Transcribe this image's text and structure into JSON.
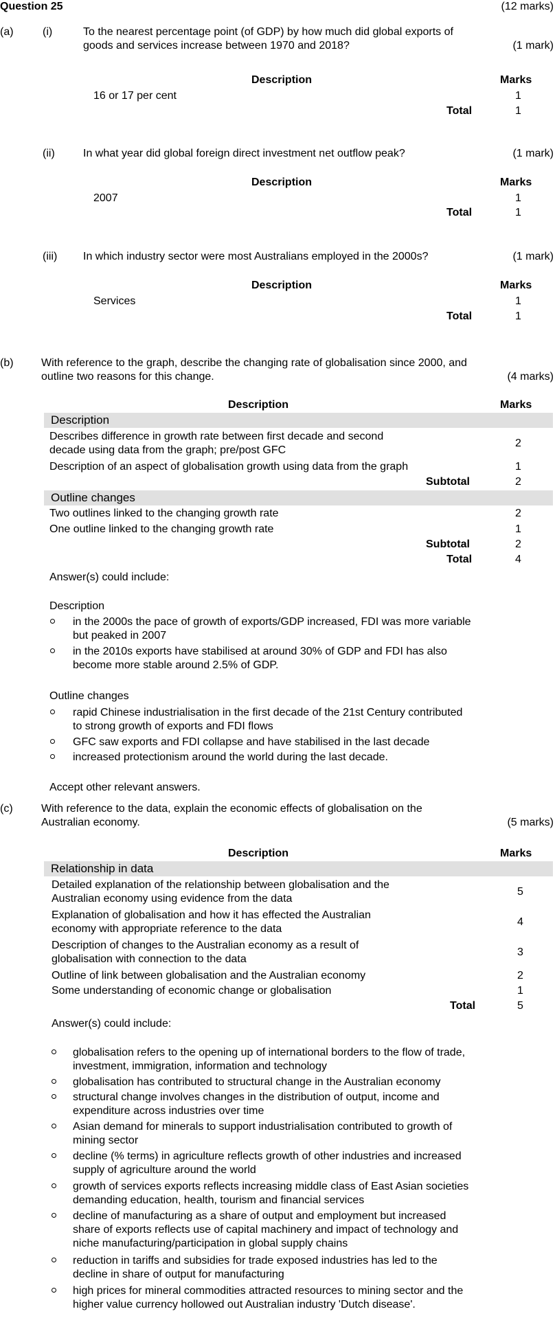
{
  "question": {
    "title": "Question 25",
    "marks": "(12 marks)"
  },
  "a": {
    "label": "(a)",
    "desc_header": "Description",
    "marks_header": "Marks",
    "total_label": "Total",
    "parts": [
      {
        "label": "(i)",
        "question_lines": [
          "To the nearest percentage point (of GDP) by how much did global exports of",
          "goods and services increase between 1970 and 2018?"
        ],
        "marks": "(1 mark)",
        "answer": "16 or 17 per cent",
        "answer_mark": "1",
        "total": "1"
      },
      {
        "label": "(ii)",
        "question_lines": [
          "In what year did global foreign direct investment net outflow peak?"
        ],
        "marks": "(1 mark)",
        "answer": "2007",
        "answer_mark": "1",
        "total": "1"
      },
      {
        "label": "(iii)",
        "question_lines": [
          "In which industry sector were most Australians employed in the 2000s?"
        ],
        "marks": "(1 mark)",
        "answer": "Services",
        "answer_mark": "1",
        "total": "1"
      }
    ]
  },
  "b": {
    "label": "(b)",
    "question_lines": [
      "With reference to the graph, describe the changing rate of globalisation since 2000, and",
      "outline two reasons for this change."
    ],
    "marks": "(4 marks)",
    "desc_header": "Description",
    "marks_header": "Marks",
    "sections": [
      {
        "title": "Description",
        "rows": [
          {
            "lines": [
              "Describes difference in growth rate between first decade and second",
              "decade using data from the graph; pre/post GFC"
            ],
            "mark": "2"
          },
          {
            "lines": [
              "Description of an aspect of globalisation growth using data from the graph"
            ],
            "mark": "1"
          }
        ],
        "subtotal_label": "Subtotal",
        "subtotal": "2"
      },
      {
        "title": "Outline changes",
        "rows": [
          {
            "lines": [
              "Two outlines linked to the changing growth rate"
            ],
            "mark": "2"
          },
          {
            "lines": [
              "One outline linked to the changing growth rate"
            ],
            "mark": "1"
          }
        ],
        "subtotal_label": "Subtotal",
        "subtotal": "2"
      }
    ],
    "total_label": "Total",
    "total": "4",
    "answers_intro": "Answer(s) could include:",
    "answer_groups": [
      {
        "heading": "Description",
        "bullets": [
          {
            "lines": [
              "in the 2000s the pace of growth of exports/GDP increased, FDI was more variable",
              "but peaked in 2007"
            ]
          },
          {
            "lines": [
              "in the 2010s exports have stabilised at around 30% of GDP and FDI has also",
              "become more stable around 2.5% of GDP."
            ]
          }
        ]
      },
      {
        "heading": "Outline changes",
        "bullets": [
          {
            "lines": [
              "rapid Chinese industrialisation in the first decade of the 21st Century contributed",
              "to strong growth of exports and FDI flows"
            ]
          },
          {
            "lines": [
              "GFC saw exports and FDI collapse and have stabilised in the last decade"
            ]
          },
          {
            "lines": [
              "increased protectionism around the world during the last decade."
            ]
          }
        ]
      }
    ],
    "accept_text": "Accept other relevant answers."
  },
  "c": {
    "label": "(c)",
    "question_lines": [
      "With reference to the data, explain the economic effects of globalisation on the",
      "Australian economy."
    ],
    "marks": "(5 marks)",
    "desc_header": "Description",
    "marks_header": "Marks",
    "section_title": "Relationship in data",
    "rows": [
      {
        "lines": [
          "Detailed explanation of the relationship between globalisation and the",
          "Australian economy using evidence from the data"
        ],
        "mark": "5"
      },
      {
        "lines": [
          "Explanation of globalisation and how it has effected the Australian",
          "economy with appropriate reference to the data"
        ],
        "mark": "4"
      },
      {
        "lines": [
          "Description of changes to the Australian economy as a result of",
          "globalisation with connection to the data"
        ],
        "mark": "3"
      },
      {
        "lines": [
          "Outline of link between globalisation and the Australian economy"
        ],
        "mark": "2"
      },
      {
        "lines": [
          "Some understanding of economic change or globalisation"
        ],
        "mark": "1"
      }
    ],
    "total_label": "Total",
    "total": "5",
    "answers_intro": "Answer(s) could include:",
    "bullets": [
      {
        "lines": [
          "globalisation refers to the opening up of international borders to the flow of trade,",
          "investment, immigration, information and technology"
        ]
      },
      {
        "lines": [
          "globalisation has contributed to structural change in the Australian economy"
        ]
      },
      {
        "lines": [
          "structural change involves changes in the distribution of output, income and",
          "expenditure across industries over time"
        ]
      },
      {
        "lines": [
          "Asian demand for minerals to support industrialisation contributed to growth of",
          "mining sector"
        ]
      },
      {
        "lines": [
          "decline (% terms) in agriculture reflects growth of other industries and increased",
          "supply of agriculture around the world"
        ]
      },
      {
        "lines": [
          "growth of services exports reflects increasing middle class of East Asian societies",
          "demanding education, health, tourism and financial services"
        ]
      },
      {
        "lines": [
          "decline of manufacturing as a share of output and employment but increased",
          "share of exports reflects use of capital machinery and impact of technology and",
          "niche manufacturing/participation in global supply chains"
        ]
      },
      {
        "lines": [
          "reduction in tariffs and subsidies for trade exposed industries has led to the",
          "decline in share of output for manufacturing"
        ]
      },
      {
        "lines": [
          "high prices for mineral commodities attracted resources to mining sector and the",
          "higher value currency hollowed out Australian industry 'Dutch disease'."
        ]
      }
    ]
  }
}
